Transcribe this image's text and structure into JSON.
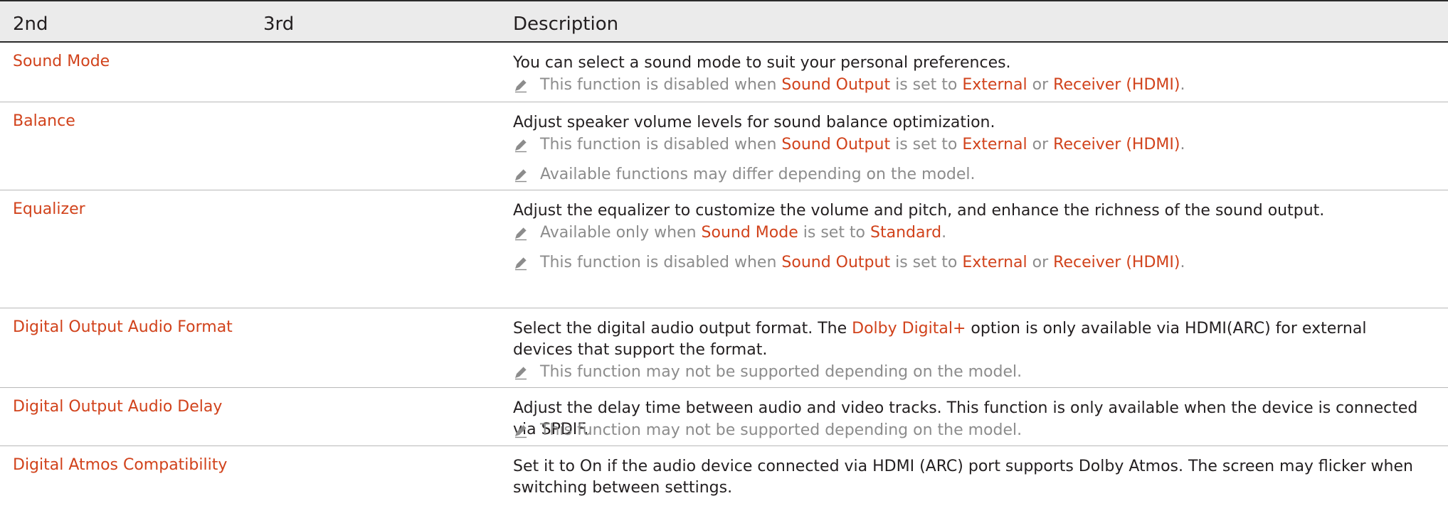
{
  "header": {
    "col1": "2nd",
    "col2": "3rd",
    "col3": "Description"
  },
  "rows": [
    {
      "label": "Sound Mode",
      "desc": "You can select a sound mode to suit your personal preferences.",
      "notes": [
        {
          "a": "This function is disabled when ",
          "b": "Sound Output",
          "c": " is set to ",
          "d": "External",
          "e": " or ",
          "f": "Receiver (HDMI)",
          "g": "."
        }
      ]
    },
    {
      "label": "Balance",
      "desc": "Adjust speaker volume levels for sound balance optimization.",
      "notes": [
        {
          "a": "This function is disabled when ",
          "b": "Sound Output",
          "c": " is set to ",
          "d": "External",
          "e": " or ",
          "f": "Receiver (HDMI)",
          "g": "."
        },
        {
          "a": "Available functions may differ depending on the model."
        }
      ]
    },
    {
      "label": "Equalizer",
      "desc": "Adjust the equalizer to customize the volume and pitch, and enhance the richness of the sound output.",
      "notes": [
        {
          "a": "Available only when ",
          "b": "Sound Mode",
          "c": " is set to ",
          "d": "Standard",
          "e": "."
        },
        {
          "a": "This function is disabled when ",
          "b": "Sound Output",
          "c": " is set to ",
          "d": "External",
          "e": " or ",
          "f": "Receiver (HDMI)",
          "g": "."
        }
      ]
    },
    {
      "label": "Digital Output Audio Format",
      "desc_a": "Select the digital audio output format. The ",
      "desc_b": "Dolby Digital+",
      "desc_c": " option is only available via HDMI(ARC) for external devices that support the format.",
      "notes": [
        {
          "a": "This function may not be supported depending on the model."
        }
      ]
    },
    {
      "label": "Digital Output Audio Delay",
      "desc": "Adjust the delay time between audio and video tracks. This function is only available when the device is connected via SPDIF.",
      "notes": [
        {
          "a": "This function may not be supported depending on the model."
        }
      ]
    },
    {
      "label": "Digital Atmos Compatibility",
      "desc": "Set it to On if the audio device connected via HDMI (ARC) port supports Dolby Atmos. The screen may flicker when switching between settings."
    }
  ],
  "icons": {
    "note": "pencil-icon"
  },
  "colors": {
    "accent": "#d1421b",
    "note_text": "#8c8c8c",
    "header_bg": "#ebebeb",
    "body_text": "#231f20"
  }
}
